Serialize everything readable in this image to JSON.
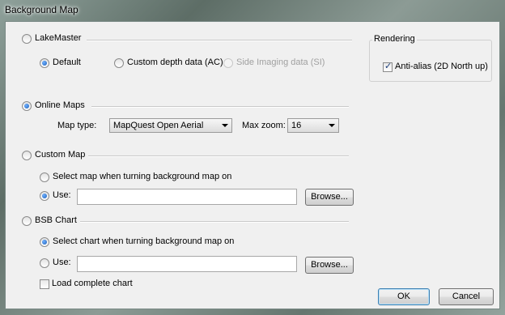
{
  "window": {
    "title": "Background Map"
  },
  "lakemaster": {
    "label": "LakeMaster",
    "options": [
      {
        "label": "Default",
        "selected": true,
        "enabled": true
      },
      {
        "label": "Custom depth data (AC)",
        "selected": false,
        "enabled": true
      },
      {
        "label": "Side Imaging data (SI)",
        "selected": false,
        "enabled": false
      }
    ]
  },
  "rendering": {
    "legend": "Rendering",
    "antialias_label": "Anti-alias (2D North up)",
    "antialias_checked": true
  },
  "online_maps": {
    "label": "Online Maps",
    "selected": true,
    "map_type_label": "Map type:",
    "map_type_value": "MapQuest Open Aerial",
    "max_zoom_label": "Max zoom:",
    "max_zoom_value": "16"
  },
  "custom_map": {
    "label": "Custom Map",
    "selected": false,
    "select_label": "Select map when turning background map on",
    "use_label": "Use:",
    "use_selected": true,
    "use_value": "",
    "browse_label": "Browse..."
  },
  "bsb_chart": {
    "label": "BSB Chart",
    "selected": false,
    "select_label": "Select chart when turning background map on",
    "select_selected": true,
    "use_label": "Use:",
    "use_value": "",
    "browse_label": "Browse...",
    "load_complete_label": "Load complete chart",
    "load_complete_checked": false
  },
  "buttons": {
    "ok": "OK",
    "cancel": "Cancel"
  }
}
